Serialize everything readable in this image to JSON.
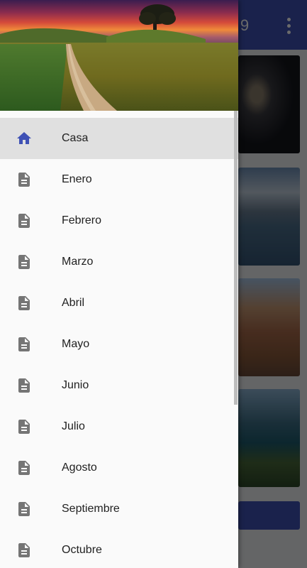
{
  "app": {
    "title_fragment": "9",
    "menu_icon": "more-vert-icon",
    "accent_color": "#3f51b5"
  },
  "drawer": {
    "header_image": "landscape-sunset-road",
    "items": [
      {
        "label": "Casa",
        "icon": "home-icon",
        "active": true
      },
      {
        "label": "Enero",
        "icon": "document-icon"
      },
      {
        "label": "Febrero",
        "icon": "document-icon"
      },
      {
        "label": "Marzo",
        "icon": "document-icon"
      },
      {
        "label": "Abril",
        "icon": "document-icon"
      },
      {
        "label": "Mayo",
        "icon": "document-icon"
      },
      {
        "label": "Junio",
        "icon": "document-icon"
      },
      {
        "label": "Julio",
        "icon": "document-icon"
      },
      {
        "label": "Agosto",
        "icon": "document-icon"
      },
      {
        "label": "Septiembre",
        "icon": "document-icon"
      },
      {
        "label": "Octubre",
        "icon": "document-icon"
      }
    ],
    "icon_color": "#757575",
    "active_icon_color": "#3f51b5"
  }
}
